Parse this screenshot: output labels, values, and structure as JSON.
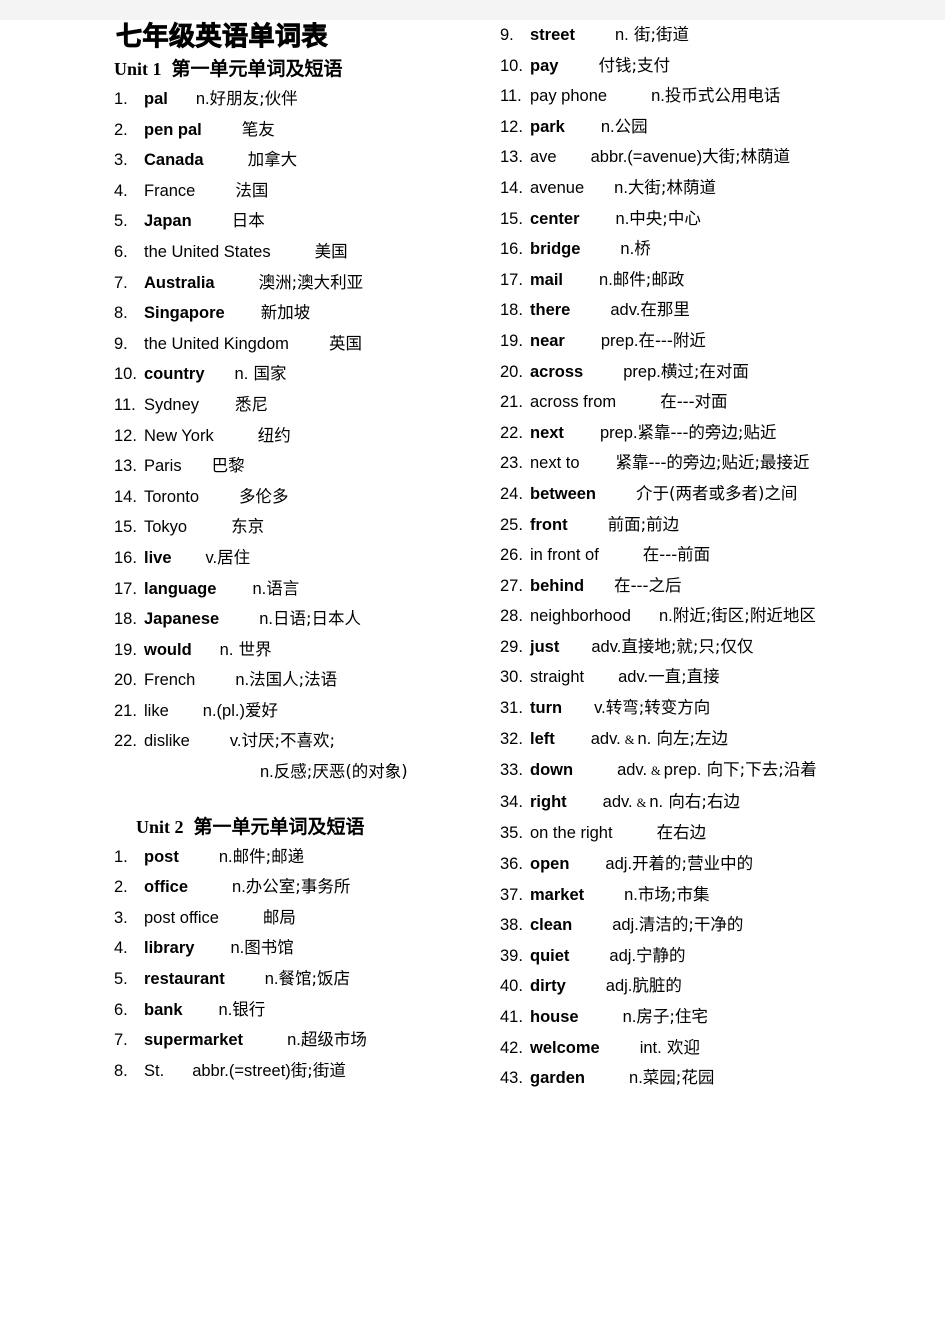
{
  "document": {
    "title": "七年级英语单词表"
  },
  "columns": {
    "left": {
      "sections": [
        {
          "heading": {
            "label": "Unit 1",
            "chinese": "第一单元单词及短语",
            "indented": false
          },
          "entries": [
            {
              "num": "1.",
              "term": "pal",
              "bold": true,
              "gap": 28,
              "pos": "n.",
              "cn": "好朋友;伙伴"
            },
            {
              "num": "2.",
              "term": "pen pal",
              "bold": true,
              "gap": 40,
              "pos": "",
              "cn": "笔友"
            },
            {
              "num": "3.",
              "term": "Canada",
              "bold": true,
              "gap": 44,
              "pos": "",
              "cn": "加拿大"
            },
            {
              "num": "4.",
              "term": "France",
              "bold": false,
              "gap": 40,
              "pos": "",
              "cn": "法国"
            },
            {
              "num": "5.",
              "term": "Japan",
              "bold": true,
              "gap": 40,
              "pos": "",
              "cn": "日本"
            },
            {
              "num": "6.",
              "term": "the United States",
              "bold": false,
              "gap": 44,
              "pos": "",
              "cn": "美国"
            },
            {
              "num": "7.",
              "term": "Australia",
              "bold": true,
              "gap": 44,
              "pos": "",
              "cn": "澳洲;澳大利亚"
            },
            {
              "num": "8.",
              "term": "Singapore",
              "bold": true,
              "gap": 36,
              "pos": "",
              "cn": "新加坡"
            },
            {
              "num": "9.",
              "term": "the United Kingdom",
              "bold": false,
              "gap": 40,
              "pos": "",
              "cn": "英国"
            },
            {
              "num": "10.",
              "term": "country",
              "bold": true,
              "gap": 30,
              "pos": "n.",
              "cn": " 国家"
            },
            {
              "num": "11.",
              "term": "Sydney",
              "bold": false,
              "gap": 36,
              "pos": "",
              "cn": "悉尼"
            },
            {
              "num": "12.",
              "term": "New York",
              "bold": false,
              "gap": 44,
              "pos": "",
              "cn": "纽约"
            },
            {
              "num": "13.",
              "term": "Paris",
              "bold": false,
              "gap": 30,
              "pos": "",
              "cn": "巴黎"
            },
            {
              "num": "14.",
              "term": "Toronto",
              "bold": false,
              "gap": 40,
              "pos": "",
              "cn": "多伦多"
            },
            {
              "num": "15.",
              "term": "Tokyo",
              "bold": false,
              "gap": 44,
              "pos": "",
              "cn": "东京"
            },
            {
              "num": "16.",
              "term": "live",
              "bold": true,
              "gap": 34,
              "pos": "v.",
              "cn": "居住"
            },
            {
              "num": "17.",
              "term": "language",
              "bold": true,
              "gap": 36,
              "pos": "n.",
              "cn": "语言"
            },
            {
              "num": "18.",
              "term": "Japanese",
              "bold": true,
              "gap": 40,
              "pos": "n.",
              "cn": "日语;日本人"
            },
            {
              "num": "19.",
              "term": "would",
              "bold": true,
              "gap": 28,
              "pos": "n.",
              "cn": " 世界"
            },
            {
              "num": "20.",
              "term": "French",
              "bold": false,
              "gap": 40,
              "pos": "n.",
              "cn": "法国人;法语"
            },
            {
              "num": "21.",
              "term": "like",
              "bold": false,
              "gap": 34,
              "pos": "n.(pl.)",
              "cn": "爱好"
            },
            {
              "num": "22.",
              "term": "dislike",
              "bold": false,
              "gap": 40,
              "pos": "v.",
              "cn": "讨厌;不喜欢;",
              "continuation": {
                "pos": "n.",
                "cn": "反感;厌恶(的对象)"
              }
            }
          ]
        },
        {
          "heading": {
            "label": "Unit 2",
            "chinese": "第一单元单词及短语",
            "indented": true
          },
          "entries": [
            {
              "num": "1.",
              "term": "post",
              "bold": true,
              "gap": 40,
              "pos": "n.",
              "cn": "邮件;邮递"
            },
            {
              "num": "2.",
              "term": "office",
              "bold": true,
              "gap": 44,
              "pos": "n.",
              "cn": "办公室;事务所"
            },
            {
              "num": "3.",
              "term": "post office",
              "bold": false,
              "gap": 44,
              "pos": "",
              "cn": "邮局"
            },
            {
              "num": "4.",
              "term": "library",
              "bold": true,
              "gap": 36,
              "pos": "n.",
              "cn": "图书馆"
            },
            {
              "num": "5.",
              "term": "restaurant",
              "bold": true,
              "gap": 40,
              "pos": "n.",
              "cn": "餐馆;饭店"
            },
            {
              "num": "6.",
              "term": "bank",
              "bold": true,
              "gap": 36,
              "pos": "n.",
              "cn": "银行"
            },
            {
              "num": "7.",
              "term": "supermarket",
              "bold": true,
              "gap": 44,
              "pos": "n.",
              "cn": "超级市场"
            },
            {
              "num": "8.",
              "term": "St.",
              "bold": false,
              "gap": 28,
              "pos": "abbr.(=street)",
              "cn": "街;街道"
            }
          ]
        }
      ]
    },
    "right": {
      "sections": [
        {
          "heading": null,
          "entries": [
            {
              "num": "9.",
              "term": "street",
              "bold": true,
              "gap": 40,
              "pos": "n.",
              "cn": " 街;街道"
            },
            {
              "num": "10.",
              "term": "pay",
              "bold": true,
              "gap": 40,
              "pos": "",
              "cn": "付钱;支付"
            },
            {
              "num": "11.",
              "term": "pay phone",
              "bold": false,
              "gap": 44,
              "pos": "n.",
              "cn": "投币式公用电话"
            },
            {
              "num": "12.",
              "term": "park",
              "bold": true,
              "gap": 36,
              "pos": "n.",
              "cn": "公园"
            },
            {
              "num": "13.",
              "term": "ave",
              "bold": false,
              "gap": 34,
              "pos": "abbr.(=avenue)",
              "cn": "大街;林荫道"
            },
            {
              "num": "14.",
              "term": "avenue",
              "bold": false,
              "gap": 30,
              "pos": "n.",
              "cn": "大街;林荫道"
            },
            {
              "num": "15.",
              "term": "center",
              "bold": true,
              "gap": 36,
              "pos": "n.",
              "cn": "中央;中心"
            },
            {
              "num": "16.",
              "term": "bridge",
              "bold": true,
              "gap": 40,
              "pos": "n.",
              "cn": "桥"
            },
            {
              "num": "17.",
              "term": "mail",
              "bold": true,
              "gap": 36,
              "pos": "n.",
              "cn": "邮件;邮政"
            },
            {
              "num": "18.",
              "term": "there",
              "bold": true,
              "gap": 40,
              "pos": "adv.",
              "cn": "在那里"
            },
            {
              "num": "19.",
              "term": "near",
              "bold": true,
              "gap": 36,
              "pos": "prep.",
              "cn": "在---附近"
            },
            {
              "num": "20.",
              "term": "across",
              "bold": true,
              "gap": 40,
              "pos": "prep.",
              "cn": "横过;在对面"
            },
            {
              "num": "21.",
              "term": "across from",
              "bold": false,
              "gap": 44,
              "pos": "",
              "cn": "在---对面"
            },
            {
              "num": "22.",
              "term": "next",
              "bold": true,
              "gap": 36,
              "pos": "prep.",
              "cn": "紧靠---的旁边;贴近"
            },
            {
              "num": "23.",
              "term": "next to",
              "bold": false,
              "gap": 36,
              "pos": "",
              "cn": "紧靠---的旁边;贴近;最接近"
            },
            {
              "num": "24.",
              "term": "between",
              "bold": true,
              "gap": 40,
              "pos": "",
              "cn": "介于(两者或多者)之间"
            },
            {
              "num": "25.",
              "term": "front",
              "bold": true,
              "gap": 40,
              "pos": "",
              "cn": "前面;前边"
            },
            {
              "num": "26.",
              "term": "in front of",
              "bold": false,
              "gap": 44,
              "pos": "",
              "cn": "在---前面"
            },
            {
              "num": "27.",
              "term": "behind",
              "bold": true,
              "gap": 30,
              "pos": "",
              "cn": "在---之后"
            },
            {
              "num": "28.",
              "term": "neighborhood",
              "bold": false,
              "gap": 28,
              "pos": "n.",
              "cn": "附近;街区;附近地区"
            },
            {
              "num": "29.",
              "term": "just",
              "bold": true,
              "gap": 32,
              "pos": "adv.",
              "cn": "直接地;就;只;仅仅"
            },
            {
              "num": "30.",
              "term": "straight",
              "bold": false,
              "gap": 34,
              "pos": "adv.",
              "cn": "一直;直接"
            },
            {
              "num": "31.",
              "term": "turn",
              "bold": true,
              "gap": 32,
              "pos": "v.",
              "cn": "转弯;转变方向"
            },
            {
              "num": "32.",
              "term": "left",
              "bold": true,
              "gap": 36,
              "pos": "adv.",
              "amp": "&",
              "pos2": "n.",
              "cn": " 向左;左边"
            },
            {
              "num": "33.",
              "term": "down",
              "bold": true,
              "gap": 44,
              "pos": "adv.",
              "amp": "&",
              "pos2": "prep.",
              "cn": " 向下;下去;沿着"
            },
            {
              "num": "34.",
              "term": "right",
              "bold": true,
              "gap": 36,
              "pos": "adv.",
              "amp": "&",
              "pos2": "n.",
              "cn": " 向右;右边"
            },
            {
              "num": "35.",
              "term": "on the right",
              "bold": false,
              "gap": 44,
              "pos": "",
              "cn": "在右边"
            },
            {
              "num": "36.",
              "term": "open",
              "bold": true,
              "gap": 36,
              "pos": "adj.",
              "cn": "开着的;营业中的"
            },
            {
              "num": "37.",
              "term": "market",
              "bold": true,
              "gap": 40,
              "pos": "n.",
              "cn": "市场;市集"
            },
            {
              "num": "38.",
              "term": "clean",
              "bold": true,
              "gap": 40,
              "pos": "adj.",
              "cn": "清洁的;干净的"
            },
            {
              "num": "39.",
              "term": "quiet",
              "bold": true,
              "gap": 40,
              "pos": "adj.",
              "cn": "宁静的"
            },
            {
              "num": "40.",
              "term": "dirty",
              "bold": true,
              "gap": 40,
              "pos": "adj.",
              "cn": "肮脏的"
            },
            {
              "num": "41.",
              "term": "house",
              "bold": true,
              "gap": 44,
              "pos": "n.",
              "cn": "房子;住宅"
            },
            {
              "num": "42.",
              "term": "welcome",
              "bold": true,
              "gap": 40,
              "pos": "int.",
              "cn": " 欢迎"
            },
            {
              "num": "43.",
              "term": "garden",
              "bold": true,
              "gap": 44,
              "pos": "n.",
              "cn": "菜园;花园"
            }
          ]
        }
      ]
    }
  }
}
